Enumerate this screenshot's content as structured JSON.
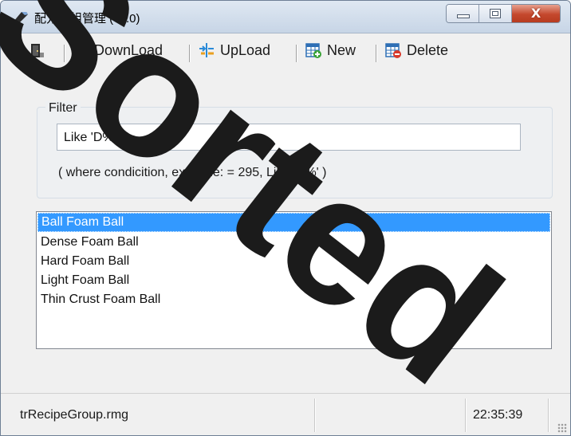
{
  "window": {
    "title": "配方群組管理 (v1.0)",
    "icon": "pen-icon",
    "close_glyph": "X"
  },
  "toolbar": {
    "items": [
      {
        "label": "",
        "icon": "exit-door-icon"
      },
      {
        "label": "DownLoad",
        "icon": "download-icon"
      },
      {
        "label": "UpLoad",
        "icon": "upload-icon"
      },
      {
        "label": "New",
        "icon": "table-add-icon"
      },
      {
        "label": "Delete",
        "icon": "table-delete-icon"
      }
    ]
  },
  "filter": {
    "group_label": "Filter",
    "value": "Like 'D%'",
    "hint": "( where condicition, example: = 295, Like 'D%' )"
  },
  "list": {
    "items": [
      {
        "label": "Ball  Foam Ball",
        "selected": true
      },
      {
        "label": "Dense Foam Ball",
        "selected": false
      },
      {
        "label": "Hard Foam Ball",
        "selected": false
      },
      {
        "label": "Light Foam Ball",
        "selected": false
      },
      {
        "label": "Thin Crust Foam Ball",
        "selected": false
      }
    ]
  },
  "statusbar": {
    "file": "trRecipeGroup.rmg",
    "time": "22:35:39"
  },
  "watermark": {
    "text": "Sorted",
    "color": "#1b1b1b"
  },
  "colors": {
    "selection": "#3399ff",
    "close_button": "#c4482d"
  }
}
